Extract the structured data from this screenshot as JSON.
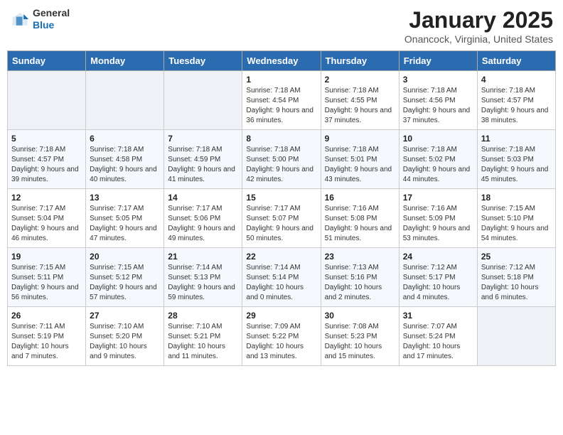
{
  "header": {
    "logo_general": "General",
    "logo_blue": "Blue",
    "title": "January 2025",
    "location": "Onancock, Virginia, United States"
  },
  "weekdays": [
    "Sunday",
    "Monday",
    "Tuesday",
    "Wednesday",
    "Thursday",
    "Friday",
    "Saturday"
  ],
  "weeks": [
    [
      {
        "day": "",
        "info": ""
      },
      {
        "day": "",
        "info": ""
      },
      {
        "day": "",
        "info": ""
      },
      {
        "day": "1",
        "info": "Sunrise: 7:18 AM\nSunset: 4:54 PM\nDaylight: 9 hours and 36 minutes."
      },
      {
        "day": "2",
        "info": "Sunrise: 7:18 AM\nSunset: 4:55 PM\nDaylight: 9 hours and 37 minutes."
      },
      {
        "day": "3",
        "info": "Sunrise: 7:18 AM\nSunset: 4:56 PM\nDaylight: 9 hours and 37 minutes."
      },
      {
        "day": "4",
        "info": "Sunrise: 7:18 AM\nSunset: 4:57 PM\nDaylight: 9 hours and 38 minutes."
      }
    ],
    [
      {
        "day": "5",
        "info": "Sunrise: 7:18 AM\nSunset: 4:57 PM\nDaylight: 9 hours and 39 minutes."
      },
      {
        "day": "6",
        "info": "Sunrise: 7:18 AM\nSunset: 4:58 PM\nDaylight: 9 hours and 40 minutes."
      },
      {
        "day": "7",
        "info": "Sunrise: 7:18 AM\nSunset: 4:59 PM\nDaylight: 9 hours and 41 minutes."
      },
      {
        "day": "8",
        "info": "Sunrise: 7:18 AM\nSunset: 5:00 PM\nDaylight: 9 hours and 42 minutes."
      },
      {
        "day": "9",
        "info": "Sunrise: 7:18 AM\nSunset: 5:01 PM\nDaylight: 9 hours and 43 minutes."
      },
      {
        "day": "10",
        "info": "Sunrise: 7:18 AM\nSunset: 5:02 PM\nDaylight: 9 hours and 44 minutes."
      },
      {
        "day": "11",
        "info": "Sunrise: 7:18 AM\nSunset: 5:03 PM\nDaylight: 9 hours and 45 minutes."
      }
    ],
    [
      {
        "day": "12",
        "info": "Sunrise: 7:17 AM\nSunset: 5:04 PM\nDaylight: 9 hours and 46 minutes."
      },
      {
        "day": "13",
        "info": "Sunrise: 7:17 AM\nSunset: 5:05 PM\nDaylight: 9 hours and 47 minutes."
      },
      {
        "day": "14",
        "info": "Sunrise: 7:17 AM\nSunset: 5:06 PM\nDaylight: 9 hours and 49 minutes."
      },
      {
        "day": "15",
        "info": "Sunrise: 7:17 AM\nSunset: 5:07 PM\nDaylight: 9 hours and 50 minutes."
      },
      {
        "day": "16",
        "info": "Sunrise: 7:16 AM\nSunset: 5:08 PM\nDaylight: 9 hours and 51 minutes."
      },
      {
        "day": "17",
        "info": "Sunrise: 7:16 AM\nSunset: 5:09 PM\nDaylight: 9 hours and 53 minutes."
      },
      {
        "day": "18",
        "info": "Sunrise: 7:15 AM\nSunset: 5:10 PM\nDaylight: 9 hours and 54 minutes."
      }
    ],
    [
      {
        "day": "19",
        "info": "Sunrise: 7:15 AM\nSunset: 5:11 PM\nDaylight: 9 hours and 56 minutes."
      },
      {
        "day": "20",
        "info": "Sunrise: 7:15 AM\nSunset: 5:12 PM\nDaylight: 9 hours and 57 minutes."
      },
      {
        "day": "21",
        "info": "Sunrise: 7:14 AM\nSunset: 5:13 PM\nDaylight: 9 hours and 59 minutes."
      },
      {
        "day": "22",
        "info": "Sunrise: 7:14 AM\nSunset: 5:14 PM\nDaylight: 10 hours and 0 minutes."
      },
      {
        "day": "23",
        "info": "Sunrise: 7:13 AM\nSunset: 5:16 PM\nDaylight: 10 hours and 2 minutes."
      },
      {
        "day": "24",
        "info": "Sunrise: 7:12 AM\nSunset: 5:17 PM\nDaylight: 10 hours and 4 minutes."
      },
      {
        "day": "25",
        "info": "Sunrise: 7:12 AM\nSunset: 5:18 PM\nDaylight: 10 hours and 6 minutes."
      }
    ],
    [
      {
        "day": "26",
        "info": "Sunrise: 7:11 AM\nSunset: 5:19 PM\nDaylight: 10 hours and 7 minutes."
      },
      {
        "day": "27",
        "info": "Sunrise: 7:10 AM\nSunset: 5:20 PM\nDaylight: 10 hours and 9 minutes."
      },
      {
        "day": "28",
        "info": "Sunrise: 7:10 AM\nSunset: 5:21 PM\nDaylight: 10 hours and 11 minutes."
      },
      {
        "day": "29",
        "info": "Sunrise: 7:09 AM\nSunset: 5:22 PM\nDaylight: 10 hours and 13 minutes."
      },
      {
        "day": "30",
        "info": "Sunrise: 7:08 AM\nSunset: 5:23 PM\nDaylight: 10 hours and 15 minutes."
      },
      {
        "day": "31",
        "info": "Sunrise: 7:07 AM\nSunset: 5:24 PM\nDaylight: 10 hours and 17 minutes."
      },
      {
        "day": "",
        "info": ""
      }
    ]
  ]
}
